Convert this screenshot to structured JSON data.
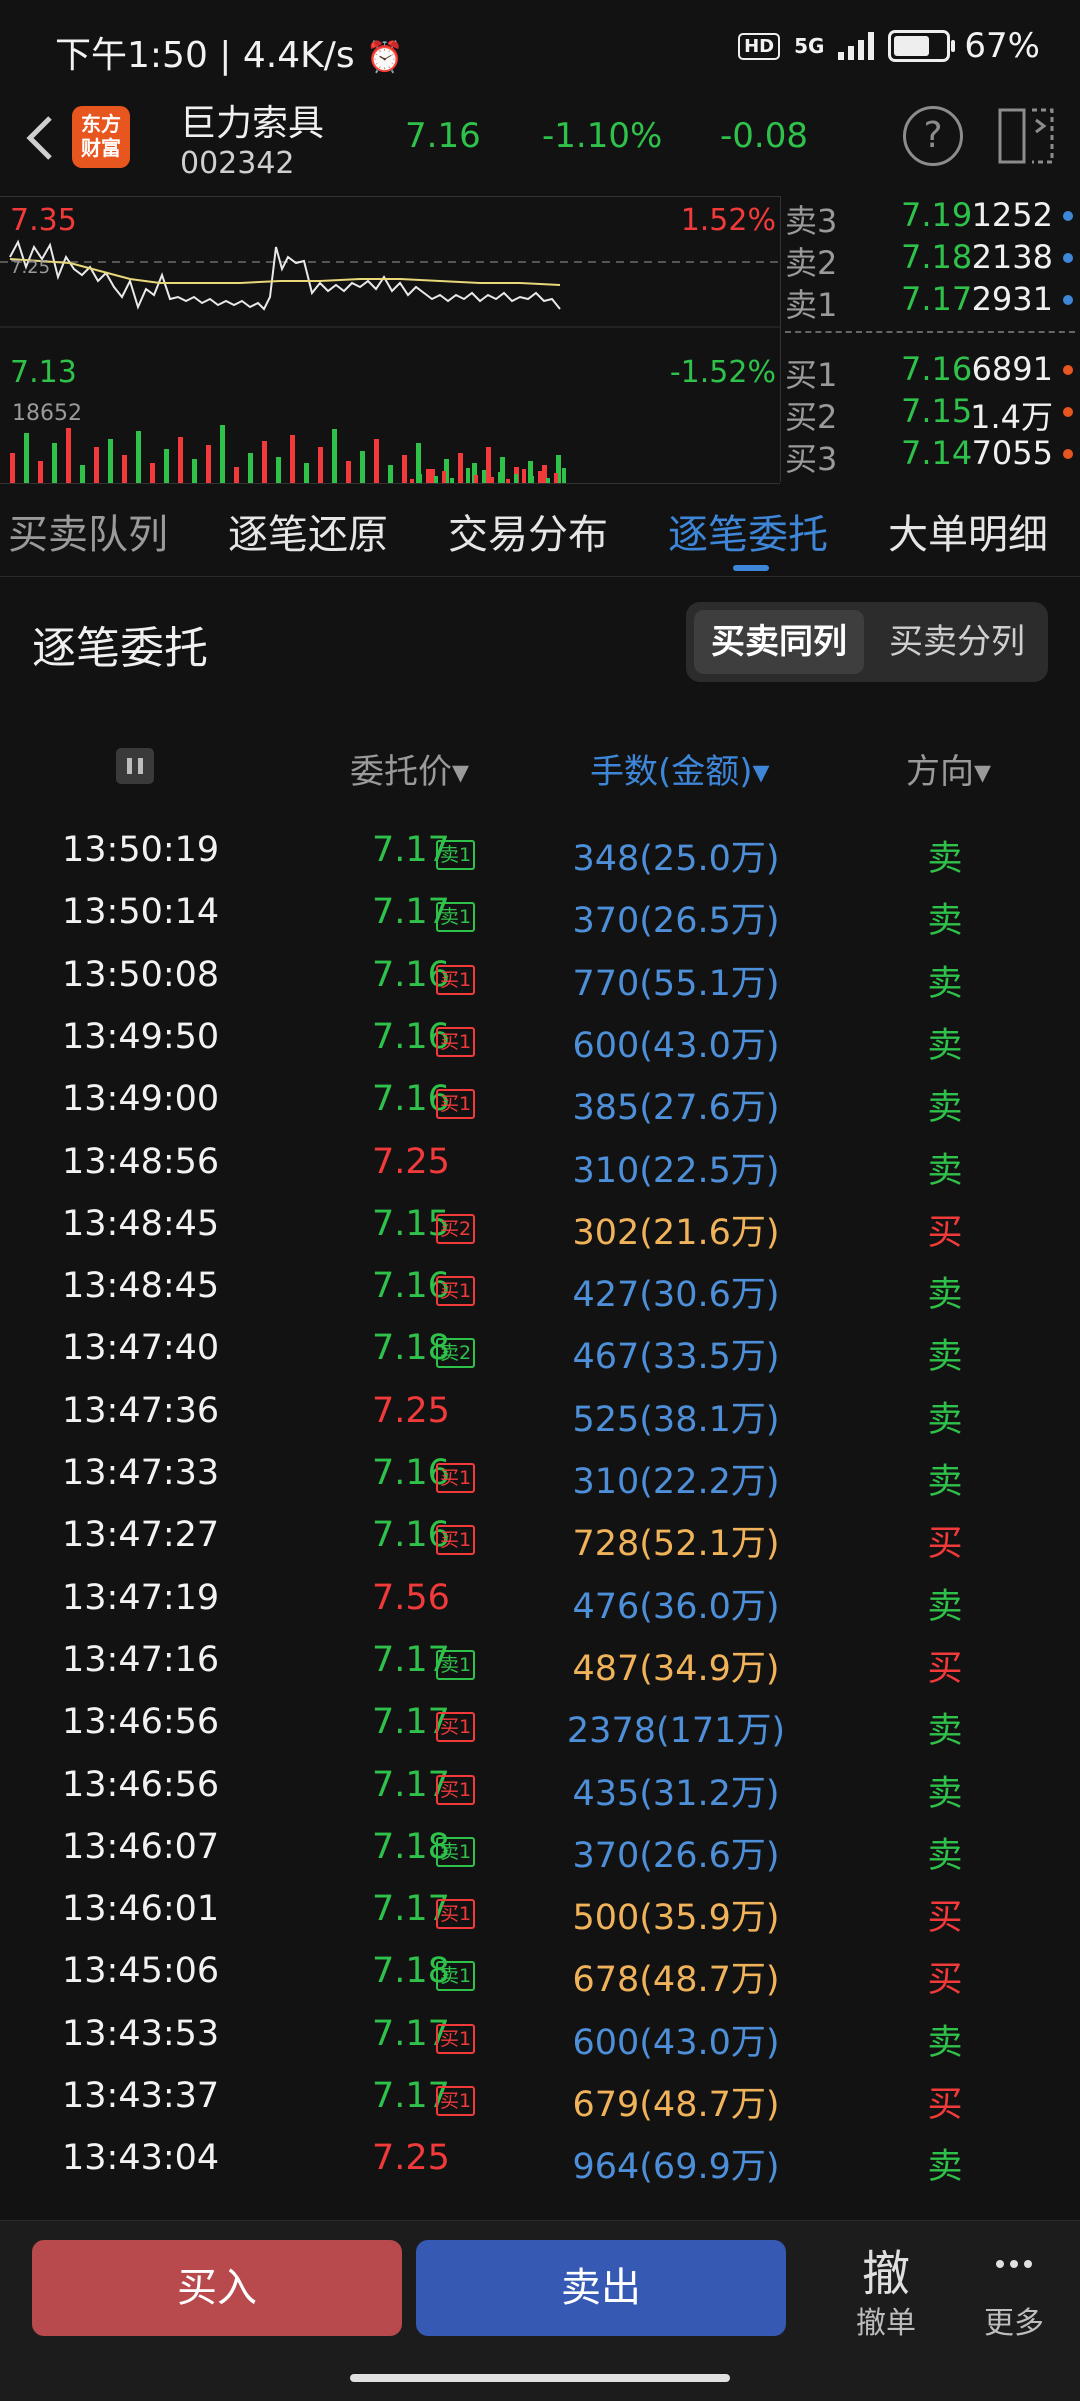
{
  "status": {
    "time": "下午1:50",
    "speed": "4.4K/s",
    "hd": "HD",
    "net": "5G",
    "battery": "67%"
  },
  "stock": {
    "logo_top": "东方",
    "logo_bottom": "财富",
    "name": "巨力索具",
    "code": "002342",
    "price": "7.16",
    "change_pct": "-1.10%",
    "change": "-0.08",
    "help": "?"
  },
  "mini_chart": {
    "high": "7.35",
    "low": "7.13",
    "high_pct": "1.52%",
    "low_pct": "-1.52%",
    "volume_label": "18652",
    "prev_close_marker": "7.25"
  },
  "orderbook": {
    "asks": [
      {
        "label": "卖3",
        "price": "7.19",
        "vol": "1252"
      },
      {
        "label": "卖2",
        "price": "7.18",
        "vol": "2138"
      },
      {
        "label": "卖1",
        "price": "7.17",
        "vol": "2931"
      }
    ],
    "bids": [
      {
        "label": "买1",
        "price": "7.16",
        "vol": "6891"
      },
      {
        "label": "买2",
        "price": "7.15",
        "vol": "1.4万"
      },
      {
        "label": "买3",
        "price": "7.14",
        "vol": "7055"
      }
    ]
  },
  "tabs": [
    "买卖队列",
    "逐笔还原",
    "交易分布",
    "逐笔委托",
    "大单明细"
  ],
  "section": {
    "title": "逐笔委托",
    "toggle_same": "买卖同列",
    "toggle_split": "买卖分列"
  },
  "table": {
    "col_price": "委托价▾",
    "col_qty": "手数(金额)▾",
    "col_dir": "方向▾",
    "rows": [
      {
        "time": "13:50:19",
        "price": "7.17",
        "badge": "卖1",
        "qty": "348(25.0万)",
        "dir": "卖"
      },
      {
        "time": "13:50:14",
        "price": "7.17",
        "badge": "卖1",
        "qty": "370(26.5万)",
        "dir": "卖"
      },
      {
        "time": "13:50:08",
        "price": "7.16",
        "badge": "买1",
        "qty": "770(55.1万)",
        "dir": "卖"
      },
      {
        "time": "13:49:50",
        "price": "7.16",
        "badge": "买1",
        "qty": "600(43.0万)",
        "dir": "卖"
      },
      {
        "time": "13:49:00",
        "price": "7.16",
        "badge": "买1",
        "qty": "385(27.6万)",
        "dir": "卖"
      },
      {
        "time": "13:48:56",
        "price": "7.25",
        "badge": "",
        "qty": "310(22.5万)",
        "dir": "卖"
      },
      {
        "time": "13:48:45",
        "price": "7.15",
        "badge": "买2",
        "qty": "302(21.6万)",
        "dir": "买"
      },
      {
        "time": "13:48:45",
        "price": "7.16",
        "badge": "买1",
        "qty": "427(30.6万)",
        "dir": "卖"
      },
      {
        "time": "13:47:40",
        "price": "7.18",
        "badge": "卖2",
        "qty": "467(33.5万)",
        "dir": "卖"
      },
      {
        "time": "13:47:36",
        "price": "7.25",
        "badge": "",
        "qty": "525(38.1万)",
        "dir": "卖"
      },
      {
        "time": "13:47:33",
        "price": "7.16",
        "badge": "买1",
        "qty": "310(22.2万)",
        "dir": "卖"
      },
      {
        "time": "13:47:27",
        "price": "7.16",
        "badge": "买1",
        "qty": "728(52.1万)",
        "dir": "买"
      },
      {
        "time": "13:47:19",
        "price": "7.56",
        "badge": "",
        "qty": "476(36.0万)",
        "dir": "卖"
      },
      {
        "time": "13:47:16",
        "price": "7.17",
        "badge": "卖1",
        "qty": "487(34.9万)",
        "dir": "买"
      },
      {
        "time": "13:46:56",
        "price": "7.17",
        "badge": "买1",
        "qty": "2378(171万)",
        "dir": "卖"
      },
      {
        "time": "13:46:56",
        "price": "7.17",
        "badge": "买1",
        "qty": "435(31.2万)",
        "dir": "卖"
      },
      {
        "time": "13:46:07",
        "price": "7.18",
        "badge": "卖1",
        "qty": "370(26.6万)",
        "dir": "卖"
      },
      {
        "time": "13:46:01",
        "price": "7.17",
        "badge": "买1",
        "qty": "500(35.9万)",
        "dir": "买"
      },
      {
        "time": "13:45:06",
        "price": "7.18",
        "badge": "卖1",
        "qty": "678(48.7万)",
        "dir": "买"
      },
      {
        "time": "13:43:53",
        "price": "7.17",
        "badge": "买1",
        "qty": "600(43.0万)",
        "dir": "卖"
      },
      {
        "time": "13:43:37",
        "price": "7.17",
        "badge": "买1",
        "qty": "679(48.7万)",
        "dir": "买"
      },
      {
        "time": "13:43:04",
        "price": "7.25",
        "badge": "",
        "qty": "964(69.9万)",
        "dir": "卖"
      }
    ]
  },
  "bottom": {
    "buy": "买入",
    "sell": "卖出",
    "cancel_glyph": "撤",
    "cancel": "撤单",
    "more": "更多"
  },
  "colors": {
    "up": "#f23a3a",
    "down": "#2fc24b",
    "accent": "#3d86d8",
    "big_buy": "#f0b35a",
    "normal_qty": "#4d8fd8"
  }
}
